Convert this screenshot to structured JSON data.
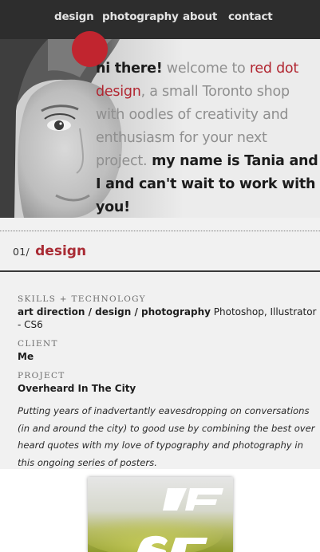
{
  "nav": {
    "items": [
      "design",
      "photography",
      "about",
      "contact"
    ]
  },
  "hero": {
    "greeting": "hi there!",
    "welcome_pre": " welcome to ",
    "brand": "red dot design",
    "welcome_post": ", a small Toronto shop with oodles of creativity and enthusiasm for your next project.",
    "intro": " my name is Tania and I and can't wait to work with you!"
  },
  "section": {
    "number": "01/",
    "title": "design"
  },
  "project": {
    "skills_label": "SKILLS + TECHNOLOGY",
    "skills_value": "art direction / design / photography",
    "skills_tools": " Photoshop, Illustrator - CS6",
    "client_label": "CLIENT",
    "client_value": "Me",
    "project_label": "PROJECT",
    "project_value": "Overheard In The City",
    "description": "Putting years of inadvertantly eavesdropping on conversations (in and around the city) to good use by combining the best over heard quotes with my love of typography and photography in this ongoing series of posters."
  },
  "colors": {
    "accent_red": "#b12631",
    "nav_bg": "#2d2d2d"
  }
}
